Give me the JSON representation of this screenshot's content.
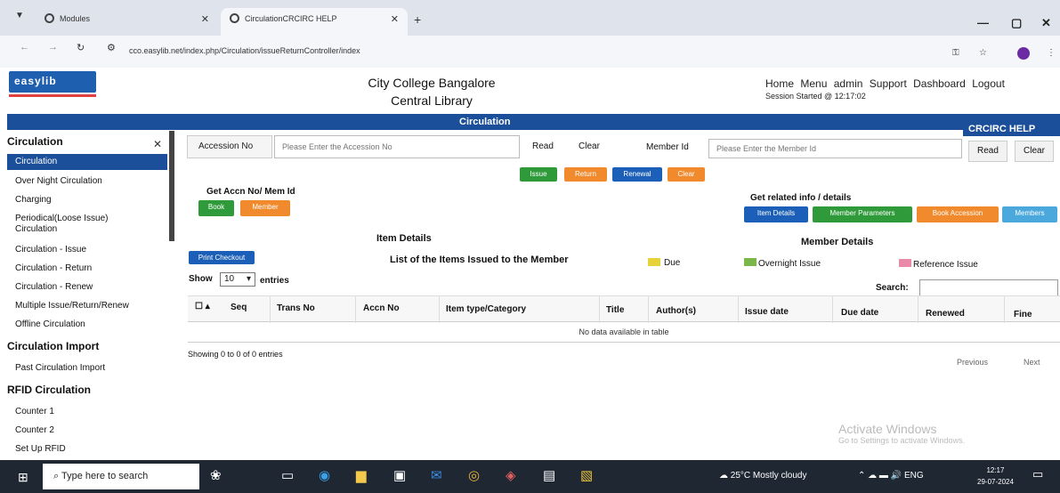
{
  "browser": {
    "tabs": [
      {
        "label": "Modules"
      },
      {
        "label": "CirculationCRCIRC HELP",
        "active": true
      }
    ],
    "new_tab": "+",
    "window_controls": [
      "—",
      "▢",
      "✕"
    ],
    "url": "cco.easylib.net/index.php/Circulation/issueReturnController/index"
  },
  "header": {
    "logo_text": "easylib",
    "college_line1": "City College Bangalore",
    "college_line2": "Central Library",
    "nav": [
      "Home",
      "Menu",
      "admin",
      "Support",
      "Dashboard",
      "Logout"
    ],
    "session": "Session Started @ 12:17:02"
  },
  "bar": {
    "title": "Circulation",
    "help": "CRCIRC HELP"
  },
  "sidebar": {
    "section1_title": "Circulation",
    "active_item": "Circulation",
    "items": [
      "Over Night Circulation",
      "Charging",
      "Periodical(Loose Issue)",
      "Circulation",
      "Circulation - Issue",
      "Circulation - Return",
      "Circulation - Renew",
      "Multiple Issue/Return/Renew",
      "Offline Circulation"
    ],
    "section2_title": "Circulation Import",
    "section2_items": [
      "Past Circulation Import"
    ],
    "section3_title": "RFID Circulation",
    "section3_items": [
      "Counter 1",
      "Counter 2",
      "Set Up RFID"
    ]
  },
  "form": {
    "accession_label": "Accession No",
    "accession_placeholder": "Please Enter the Accession No",
    "read": "Read",
    "clear": "Clear",
    "member_label": "Member Id",
    "member_placeholder": "Please Enter the Member Id",
    "issue": "Issue",
    "return": "Return",
    "renewal": "Renewal",
    "clear_small": "Clear",
    "get_accn_label": "Get Accn No/ Mem Id",
    "book": "Book",
    "member": "Member",
    "get_related_label": "Get related info / details",
    "item_details_btn": "Item Details",
    "member_parameters_btn": "Member Parameters",
    "book_accession_btn": "Book Accession",
    "members_btn": "Members"
  },
  "sections": {
    "item_details": "Item Details",
    "member_details": "Member Details",
    "list_title": "List of the Items Issued to the Member",
    "print_checkout": "Print Checkout"
  },
  "legend": [
    {
      "label": "Due",
      "color": "#e8d23a"
    },
    {
      "label": "Overnight Issue",
      "color": "#7ab648"
    },
    {
      "label": "Reference Issue",
      "color": "#e88aa8"
    }
  ],
  "table": {
    "show": "Show",
    "entries_value": "10",
    "entries": "entries",
    "search": "Search:",
    "columns": [
      "Seq",
      "Trans No",
      "Accn No",
      "Item type/Category",
      "Title",
      "Author(s)",
      "Issue date",
      "Due date",
      "Renewed",
      "Fine"
    ],
    "empty": "No data available in table",
    "info": "Showing 0 to 0 of 0 entries",
    "previous": "Previous",
    "next": "Next"
  },
  "watermark": {
    "line1": "Activate Windows",
    "line2": "Go to Settings to activate Windows."
  },
  "taskbar": {
    "search": "Type here to search",
    "weather": "25°C  Mostly cloudy",
    "lang": "ENG",
    "time": "12:17",
    "date": "29-07-2024"
  }
}
